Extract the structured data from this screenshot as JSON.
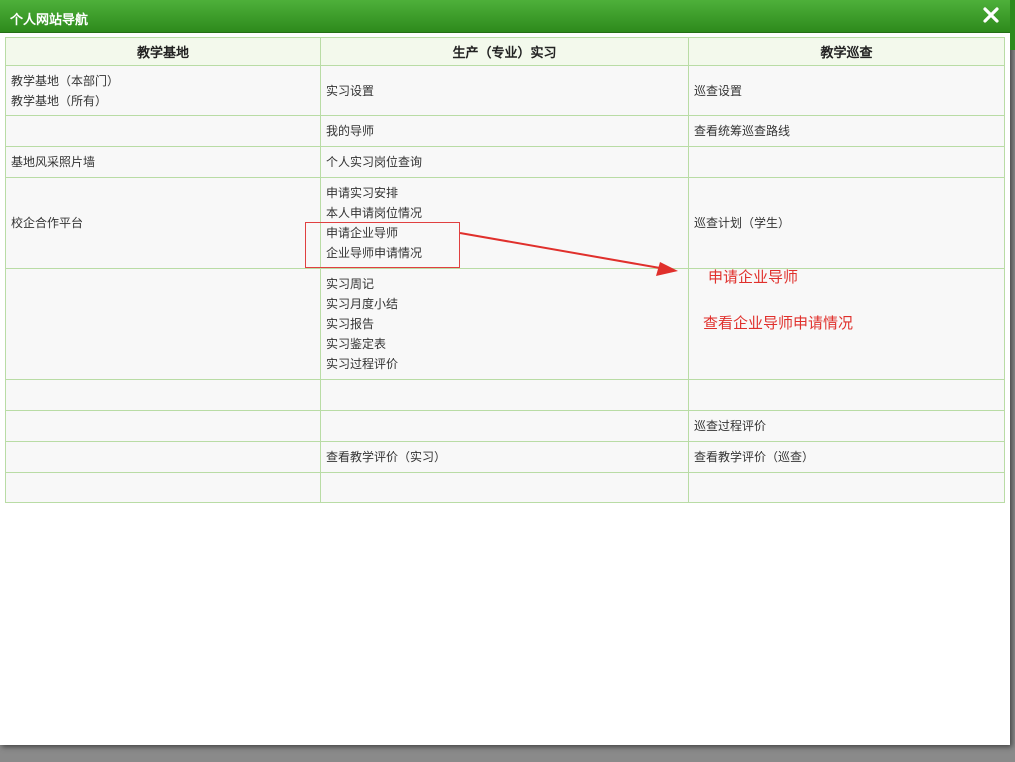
{
  "dialog": {
    "title": "个人网站导航"
  },
  "table": {
    "headers": [
      "教学基地",
      "生产（专业）实习",
      "教学巡查"
    ],
    "rows": [
      {
        "c1": [
          "教学基地（本部门）",
          "教学基地（所有）"
        ],
        "c2": [
          "实习设置"
        ],
        "c3": [
          "巡查设置"
        ]
      },
      {
        "c1": [],
        "c2": [
          "我的导师"
        ],
        "c3": [
          "查看统筹巡查路线"
        ]
      },
      {
        "c1": [
          "基地风采照片墙"
        ],
        "c2": [
          "个人实习岗位查询"
        ],
        "c3": []
      },
      {
        "c1": [
          "校企合作平台"
        ],
        "c2": [
          "申请实习安排",
          "本人申请岗位情况",
          "申请企业导师",
          "企业导师申请情况"
        ],
        "c3": [
          "巡查计划（学生）"
        ]
      },
      {
        "c1": [],
        "c2": [
          "实习周记",
          "实习月度小结",
          "实习报告",
          "实习鉴定表",
          "实习过程评价"
        ],
        "c3": []
      },
      {
        "c1": [],
        "c2": [],
        "c3": []
      },
      {
        "c1": [],
        "c2": [],
        "c3": [
          "巡查过程评价"
        ]
      },
      {
        "c1": [],
        "c2": [
          "查看教学评价（实习）"
        ],
        "c3": [
          "查看教学评价（巡查）"
        ]
      },
      {
        "c1": [],
        "c2": [],
        "c3": []
      }
    ]
  },
  "annotations": {
    "label1": "申请企业导师",
    "label2": "查看企业导师申请情况",
    "color": "#e0302c"
  }
}
